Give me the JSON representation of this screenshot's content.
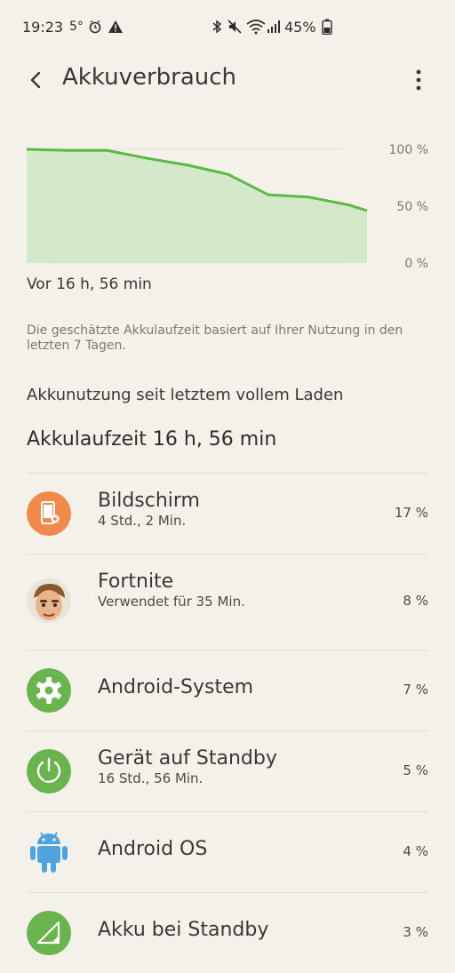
{
  "status_bar": {
    "time": "19:23",
    "temperature": "5°",
    "battery_percent": "45%"
  },
  "app_bar": {
    "title": "Akkuverbrauch"
  },
  "chart": {
    "y_ticks": [
      "100 %",
      "50 %",
      "0 %"
    ],
    "since_label": "Vor 16 h, 56 min"
  },
  "chart_data": {
    "type": "area",
    "xlabel": "",
    "ylabel": "",
    "x": [
      0,
      2,
      4,
      6,
      8,
      10,
      12,
      14,
      16,
      16.9
    ],
    "values": [
      100,
      99,
      99,
      92,
      86,
      78,
      60,
      58,
      51,
      46
    ],
    "ylim": [
      0,
      100
    ],
    "grid": true,
    "colors": {
      "line": "#5db847",
      "fill": "#c9e5bf"
    }
  },
  "note": "Die geschätzte Akkulaufzeit basiert auf Ihrer Nutzung in den letzten 7 Tagen.",
  "section_title": "Akkunutzung seit letztem vollem Laden",
  "runtime_label": "Akkulaufzeit 16 h, 56 min",
  "items": [
    {
      "title": "Bildschirm",
      "subtitle": "4 Std., 2 Min.",
      "percent": "17 %",
      "icon": "screen-icon",
      "color": "#ef8a4c"
    },
    {
      "title": "Fortnite",
      "subtitle": "Verwendet für 35 Min.",
      "percent": "8 %",
      "icon": "fortnite-avatar-icon",
      "color": "#7b5a3c"
    },
    {
      "title": "Android-System",
      "subtitle": "",
      "percent": "7 %",
      "icon": "gear-icon",
      "color": "#6ab44e"
    },
    {
      "title": "Gerät auf Standby",
      "subtitle": "16 Std., 56 Min.",
      "percent": "5 %",
      "icon": "power-icon",
      "color": "#6ab44e"
    },
    {
      "title": "Android OS",
      "subtitle": "",
      "percent": "4 %",
      "icon": "android-robot-icon",
      "color": "#4fa3e0"
    },
    {
      "title": "Akku bei Standby",
      "subtitle": "",
      "percent": "3 %",
      "icon": "signal-icon",
      "color": "#6ab44e"
    }
  ]
}
